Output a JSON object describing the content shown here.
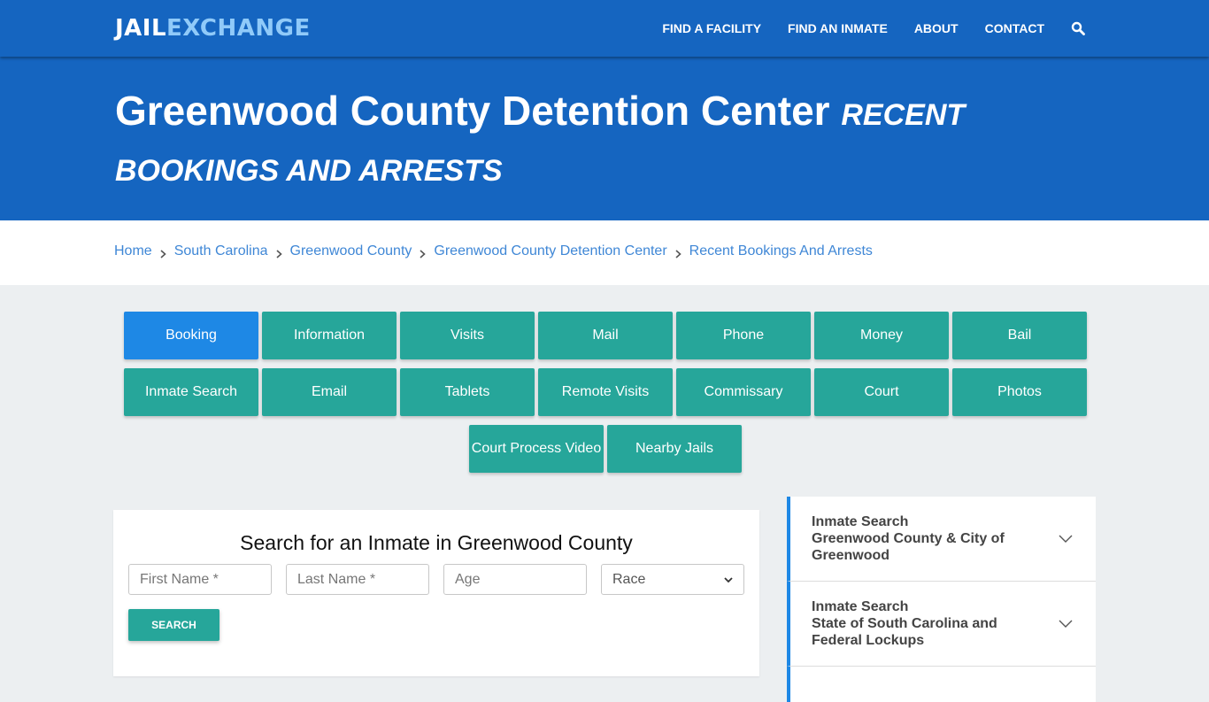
{
  "header": {
    "logo": {
      "part1": "JAIL",
      "part2": "EXCHANGE"
    },
    "nav": [
      {
        "label": "FIND A FACILITY"
      },
      {
        "label": "FIND AN INMATE"
      },
      {
        "label": "ABOUT"
      },
      {
        "label": "CONTACT"
      }
    ],
    "search_icon": "search-icon"
  },
  "hero": {
    "title": "Greenwood County Detention Center",
    "subtitle": "Recent Bookings and Arrests"
  },
  "breadcrumb": [
    {
      "label": "Home"
    },
    {
      "label": "South Carolina"
    },
    {
      "label": "Greenwood County"
    },
    {
      "label": "Greenwood County Detention Center"
    },
    {
      "label": "Recent Bookings And Arrests"
    }
  ],
  "tabs": {
    "row1": [
      {
        "label": "Booking",
        "active": true
      },
      {
        "label": "Information"
      },
      {
        "label": "Visits"
      },
      {
        "label": "Mail"
      },
      {
        "label": "Phone"
      },
      {
        "label": "Money"
      },
      {
        "label": "Bail"
      }
    ],
    "row2": [
      {
        "label": "Inmate Search"
      },
      {
        "label": "Email"
      },
      {
        "label": "Tablets"
      },
      {
        "label": "Remote Visits"
      },
      {
        "label": "Commissary"
      },
      {
        "label": "Court"
      },
      {
        "label": "Photos"
      }
    ],
    "row3": [
      {
        "label": "Court Process Video"
      },
      {
        "label": "Nearby Jails"
      }
    ]
  },
  "search_form": {
    "title": "Search for an Inmate in Greenwood County",
    "first_name_placeholder": "First Name *",
    "last_name_placeholder": "Last Name *",
    "age_placeholder": "Age",
    "race_selected": "Race",
    "submit_label": "SEARCH"
  },
  "sidebar": {
    "items": [
      {
        "line1": "Inmate Search",
        "line2": "Greenwood County & City of Greenwood"
      },
      {
        "line1": "Inmate Search",
        "line2": "State of South Carolina and Federal Lockups"
      }
    ]
  },
  "colors": {
    "brand_blue": "#1565c0",
    "logo_accent": "#90caf9",
    "tab_teal": "#26a69a",
    "tab_active": "#1e88e5",
    "link": "#3f87d6"
  }
}
